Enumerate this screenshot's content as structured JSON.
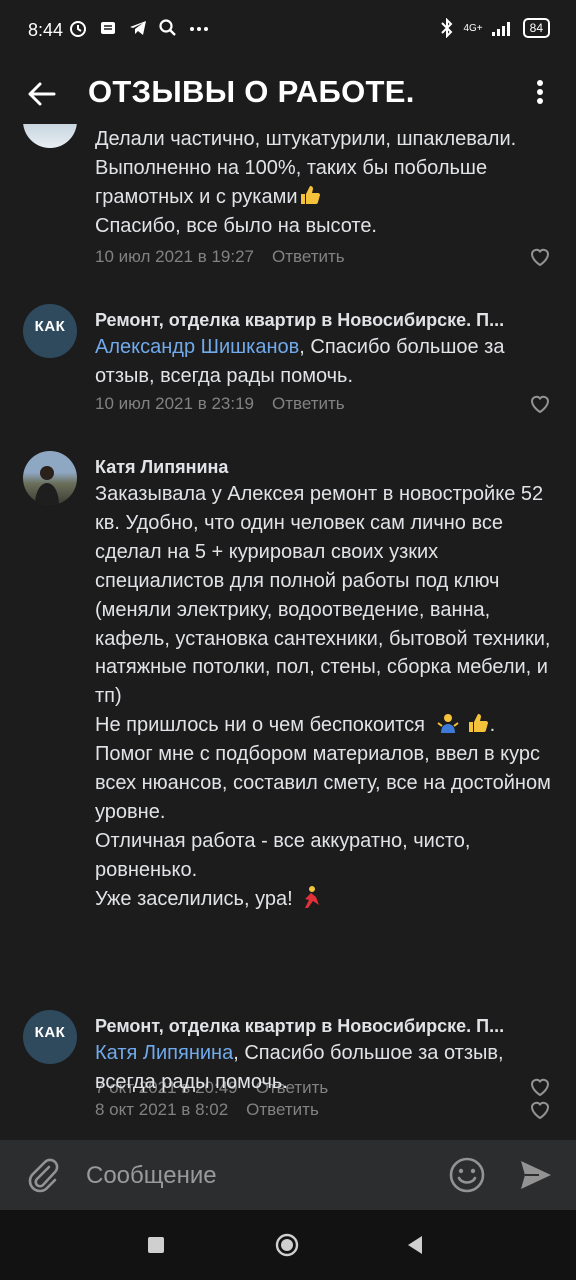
{
  "status_bar": {
    "time": "8:44",
    "network": "4G+",
    "battery": "84"
  },
  "header": {
    "title": "ОТЗЫВЫ О РАБОТЕ."
  },
  "comments": [
    {
      "author": "",
      "paragraphs": [
        "Делали частично, штукатурили, шпаклевали. Выполненно на 100%, таких бы побольше грамотных и с руками",
        "Спасибо, все было на высоте."
      ],
      "date": "10 июл 2021 в 19:27",
      "reply_label": "Ответить"
    },
    {
      "author": "Ремонт, отделка квартир в Новосибирске. П...",
      "mention": "Александр Шишканов",
      "text": ", Спасибо большое за отзыв, всегда рады помочь.",
      "date": "10 июл 2021 в 23:19",
      "reply_label": "Ответить",
      "avatar_label": "КАК"
    },
    {
      "author": "Катя Липянина",
      "paragraphs": [
        "Заказывала у Алексея ремонт в новостройке 52 кв. Удобно, что один человек сам лично все сделал на 5 + курировал своих узких специалистов для   полной работы под ключ (меняли электрику, водоотведение, ванна, кафель, установка сантехники, бытовой техники, натяжные потолки, пол, стены, сборка мебели, и тп)",
        "Не пришлось ни о чем беспокоится",
        "Помог мне  с подбором материалов, ввел в курс всех нюансов, составил смету, все на достойном уровне.",
        "Отличная работа - все аккуратно, чисто, ровненько.",
        "Уже заселились, ура!"
      ],
      "date": "7 окт 2021 в 20:49",
      "reply_label": "Ответить"
    },
    {
      "author": "Ремонт, отделка квартир в Новосибирске. П...",
      "mention": "Катя Липянина",
      "text": ", Спасибо большое за отзыв, всегда рады помочь.",
      "date": "8 окт 2021 в 8:02",
      "reply_label": "Ответить",
      "avatar_label": "КАК"
    }
  ],
  "composer": {
    "placeholder": "Сообщение"
  },
  "colors": {
    "background": "#1c1c1d",
    "link": "#71aaeb",
    "meta": "#828282",
    "composer": "#2c2d2e"
  }
}
